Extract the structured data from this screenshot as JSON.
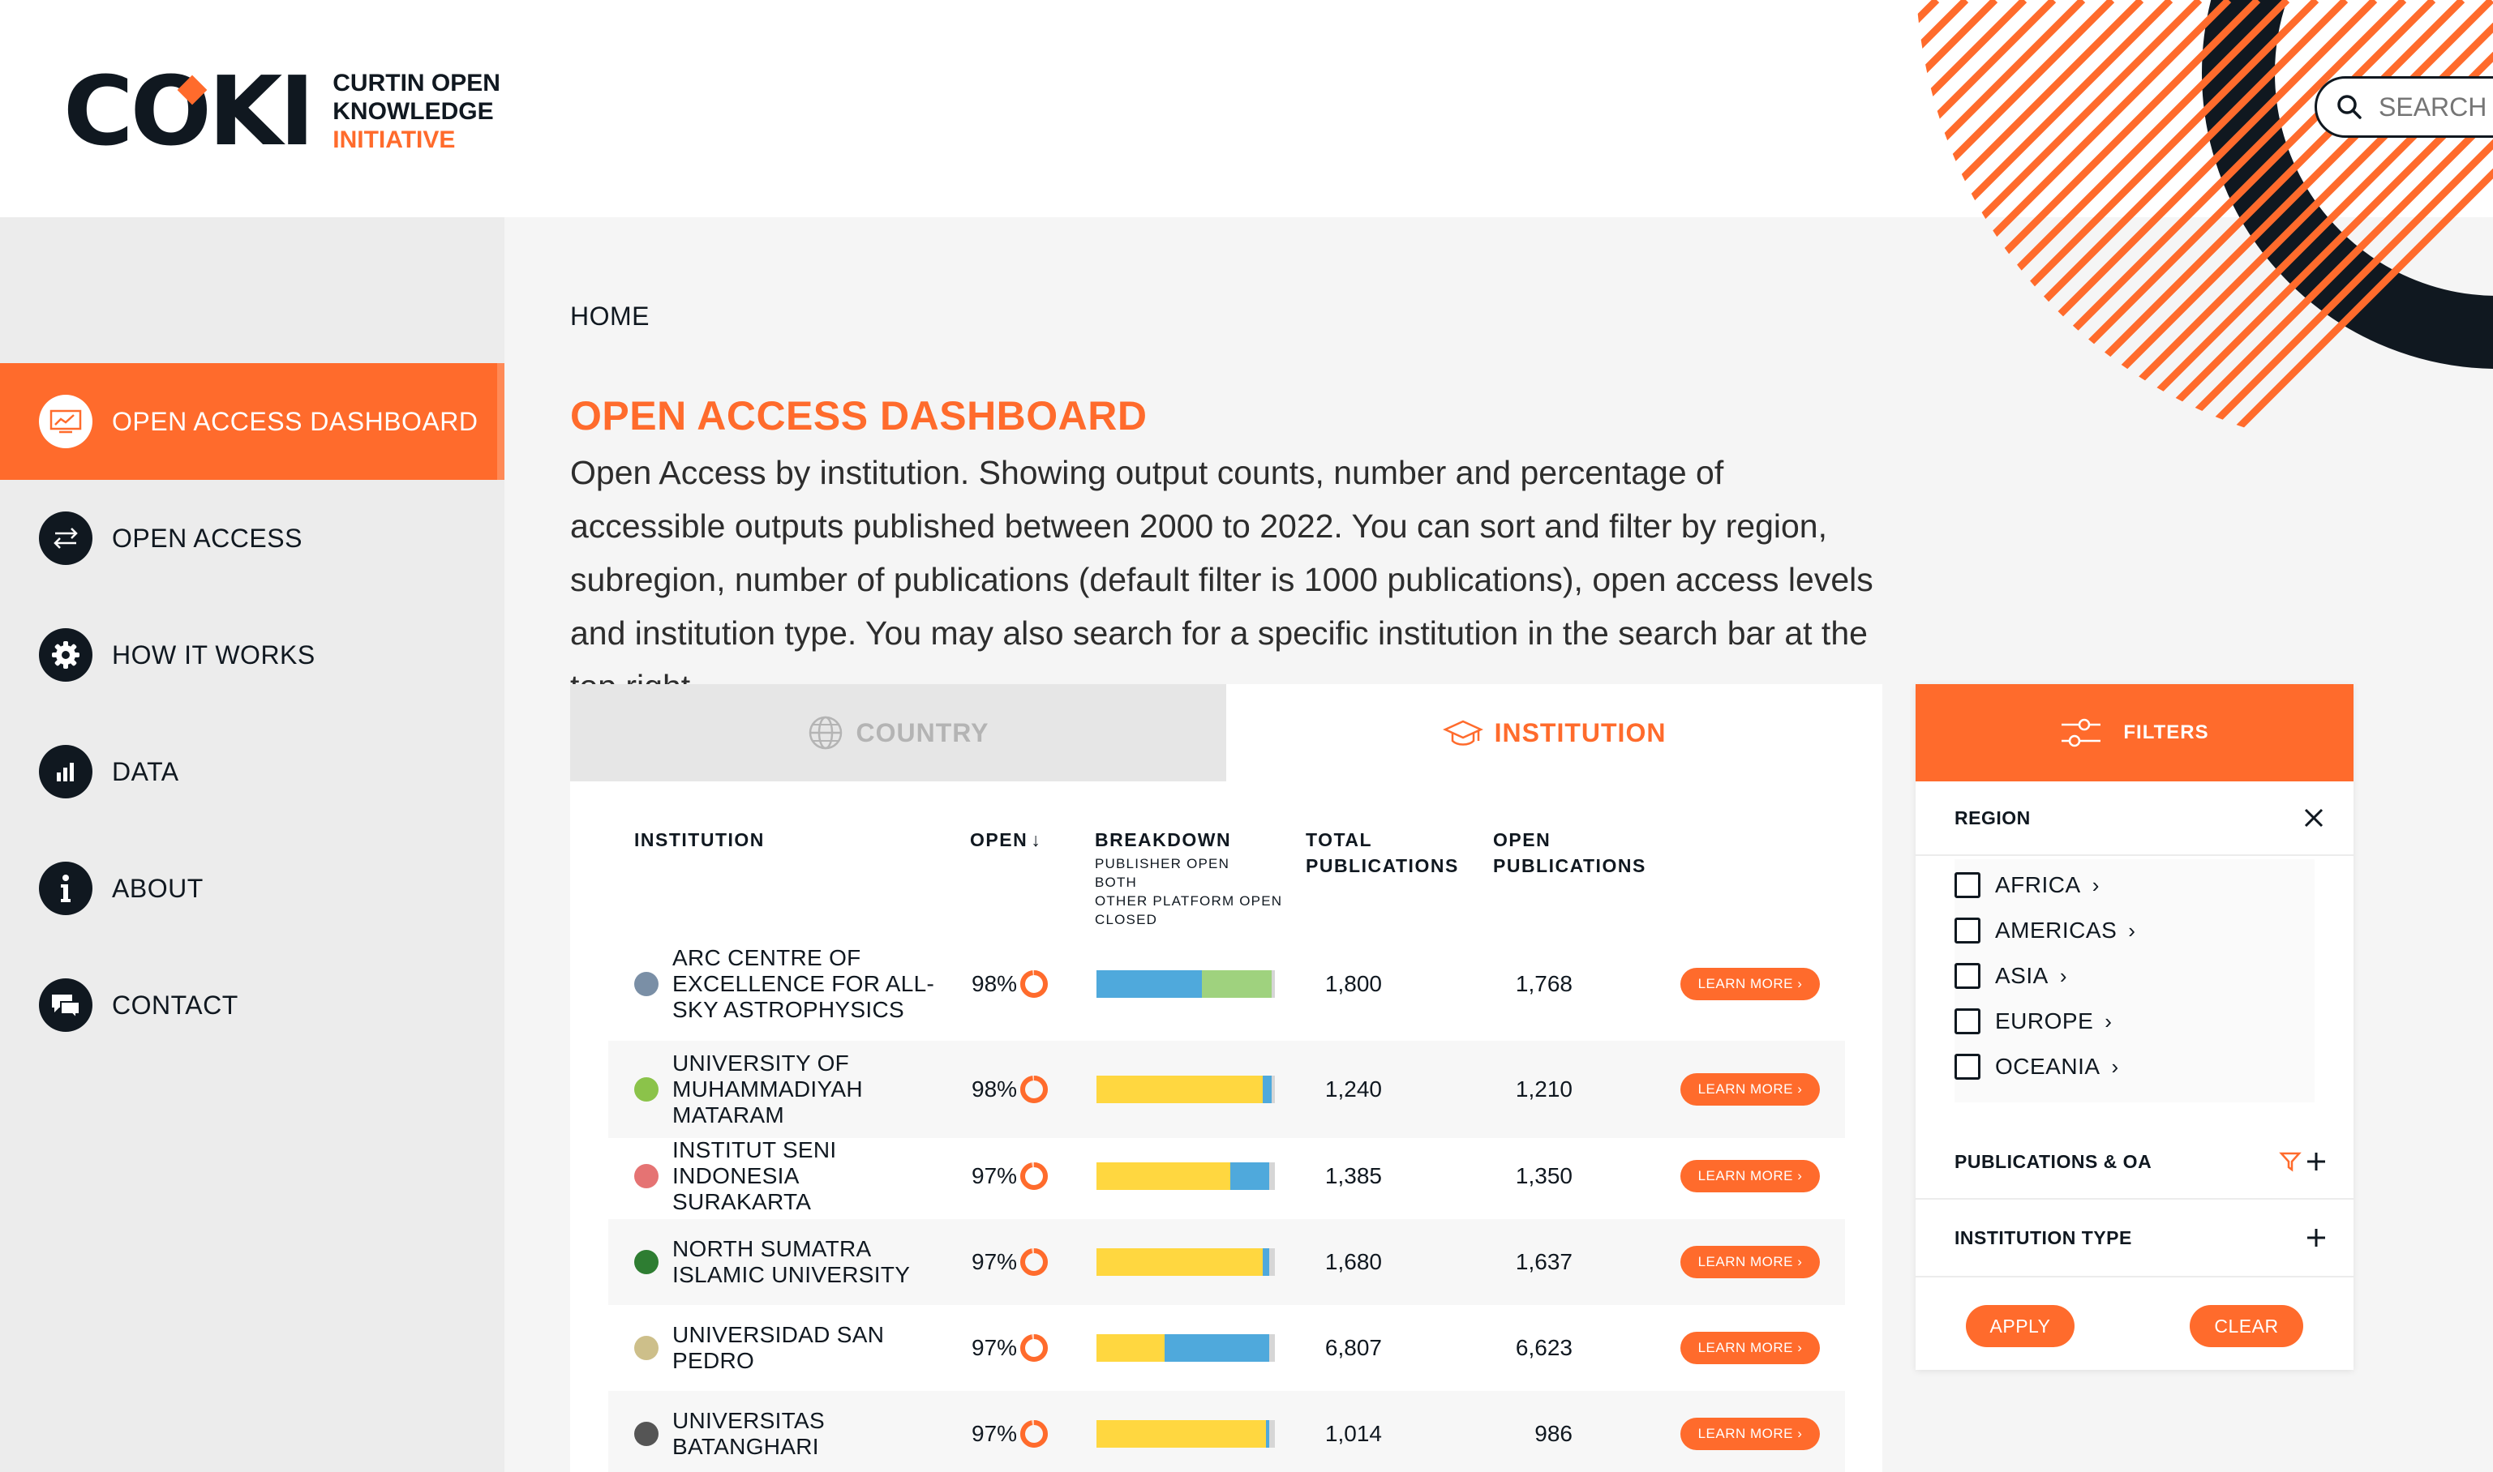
{
  "header": {
    "logo_mark": "COKI",
    "logo_line1": "CURTIN OPEN",
    "logo_line2": "KNOWLEDGE",
    "logo_line3": "INITIATIVE",
    "search_placeholder": "SEARCH"
  },
  "sidebar": {
    "items": [
      {
        "label": "OPEN ACCESS DASHBOARD",
        "icon": "dashboard-icon",
        "active": true
      },
      {
        "label": "OPEN ACCESS",
        "icon": "arrows-icon",
        "active": false
      },
      {
        "label": "HOW IT WORKS",
        "icon": "gear-icon",
        "active": false
      },
      {
        "label": "DATA",
        "icon": "bar-chart-icon",
        "active": false
      },
      {
        "label": "ABOUT",
        "icon": "info-icon",
        "active": false
      },
      {
        "label": "CONTACT",
        "icon": "chat-icon",
        "active": false
      }
    ]
  },
  "main": {
    "breadcrumb": "HOME",
    "title": "OPEN ACCESS DASHBOARD",
    "description": "Open Access by institution. Showing output counts, number and percentage of accessible outputs published between 2000 to 2022. You can sort and filter by region, subregion, number of publications (default filter is 1000 publications), open access levels and institution type. You may also search for a specific institution in the search bar at the top right.",
    "tabs": [
      {
        "label": "COUNTRY",
        "active": false
      },
      {
        "label": "INSTITUTION",
        "active": true
      }
    ]
  },
  "table": {
    "headers": {
      "institution": "INSTITUTION",
      "open": "OPEN",
      "sort_arrow": "↓",
      "breakdown": "BREAKDOWN",
      "breakdown_legend": [
        "PUBLISHER OPEN",
        "BOTH",
        "OTHER PLATFORM OPEN",
        "CLOSED"
      ],
      "total_1": "TOTAL",
      "total_2": "PUBLICATIONS",
      "open_pubs_1": "OPEN",
      "open_pubs_2": "PUBLICATIONS"
    },
    "learn_more": "LEARN MORE ›",
    "colors": {
      "publisher_open": "#ffd740",
      "both": "#4fa9dc",
      "other_platform_open": "#9fd27e",
      "closed": "#d6d6d6",
      "accent": "#ff6b2c"
    },
    "rows": [
      {
        "name": "ARC CENTRE OF EXCELLENCE FOR ALL-SKY ASTROPHYSICS",
        "open": "98%",
        "open_value": 98,
        "breakdown": [
          0,
          59,
          39,
          2
        ],
        "total": "1,800",
        "open_pubs": "1,768",
        "logo_color": "#7a8fa6"
      },
      {
        "name": "UNIVERSITY OF MUHAMMADIYAH MATARAM",
        "open": "98%",
        "open_value": 98,
        "breakdown": [
          93,
          5,
          0,
          2
        ],
        "total": "1,240",
        "open_pubs": "1,210",
        "logo_color": "#8bc34a"
      },
      {
        "name": "INSTITUT SENI INDONESIA SURAKARTA",
        "open": "97%",
        "open_value": 97,
        "breakdown": [
          75,
          22,
          0,
          3
        ],
        "total": "1,385",
        "open_pubs": "1,350",
        "logo_color": "#e57373"
      },
      {
        "name": "NORTH SUMATRA ISLAMIC UNIVERSITY",
        "open": "97%",
        "open_value": 97,
        "breakdown": [
          93,
          4,
          0,
          3
        ],
        "total": "1,680",
        "open_pubs": "1,637",
        "logo_color": "#2e7d32"
      },
      {
        "name": "UNIVERSIDAD SAN PEDRO",
        "open": "97%",
        "open_value": 97,
        "breakdown": [
          38,
          59,
          0,
          3
        ],
        "total": "6,807",
        "open_pubs": "6,623",
        "logo_color": "#cdbf8a"
      },
      {
        "name": "UNIVERSITAS BATANGHARI",
        "open": "97%",
        "open_value": 97,
        "breakdown": [
          95,
          2,
          0,
          3
        ],
        "total": "1,014",
        "open_pubs": "986",
        "logo_color": "#555555"
      }
    ]
  },
  "filters": {
    "title": "FILTERS",
    "region_label": "REGION",
    "regions": [
      "AFRICA",
      "AMERICAS",
      "ASIA",
      "EUROPE",
      "OCEANIA"
    ],
    "publications_label": "PUBLICATIONS & OA",
    "institution_type_label": "INSTITUTION TYPE",
    "apply": "APPLY",
    "clear": "CLEAR"
  }
}
